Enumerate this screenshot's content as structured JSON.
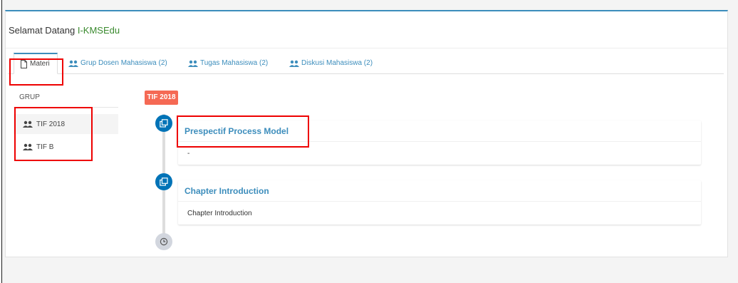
{
  "header": {
    "welcome_prefix": "Selamat Datang ",
    "welcome_brand": "I-KMSEdu"
  },
  "tabs": [
    {
      "label": "Materi",
      "icon": "file-icon",
      "active": true
    },
    {
      "label": "Grup Dosen Mahasiswa (2)",
      "icon": "users-icon",
      "active": false
    },
    {
      "label": "Tugas Mahasiswa (2)",
      "icon": "users-icon",
      "active": false
    },
    {
      "label": "Diskusi Mahasiswa (2)",
      "icon": "users-icon",
      "active": false
    }
  ],
  "sidebar": {
    "header": "GRUP",
    "items": [
      {
        "label": "TIF 2018",
        "icon": "users-icon",
        "active": true
      },
      {
        "label": "TIF B",
        "icon": "users-icon",
        "active": false
      }
    ]
  },
  "timeline": {
    "label": "TIF 2018",
    "items": [
      {
        "title": "Prespectif Process Model",
        "body": "-",
        "icon": "clone-icon"
      },
      {
        "title": "Chapter Introduction",
        "body": "Chapter Introduction",
        "icon": "clone-icon"
      }
    ],
    "end_icon": "clock-icon"
  },
  "colors": {
    "accent": "#3c8dbc",
    "brand": "#3a8a2e",
    "label_bg": "#f56954",
    "timeline_icon": "#0073b7",
    "highlight_border": "#ee0000"
  }
}
